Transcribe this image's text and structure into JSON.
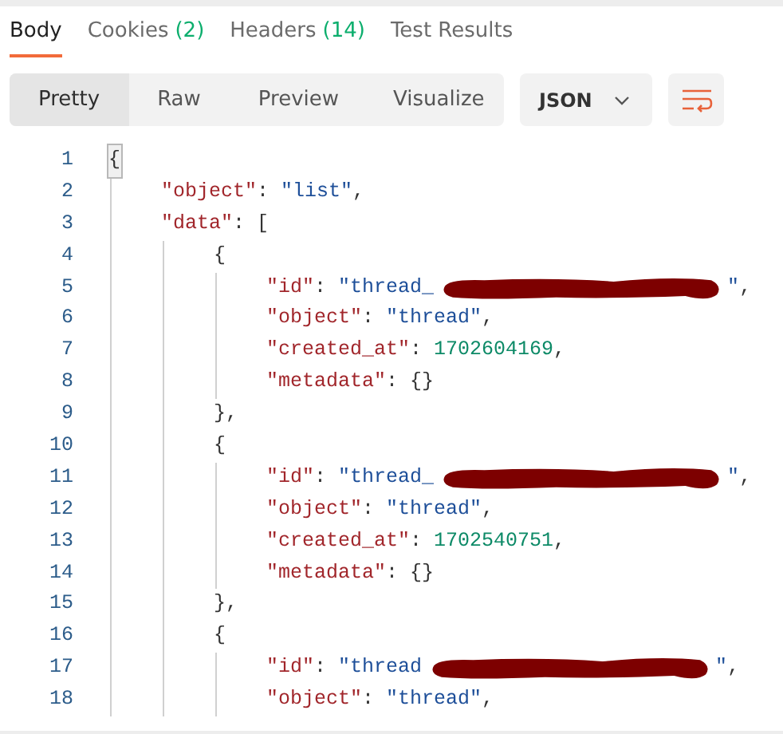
{
  "tabs": [
    {
      "label": "Body",
      "selected": true
    },
    {
      "label": "Cookies",
      "count": "(2)",
      "selected": false
    },
    {
      "label": "Headers",
      "count": "(14)",
      "selected": false
    },
    {
      "label": "Test Results",
      "selected": false
    }
  ],
  "view_modes": [
    {
      "label": "Pretty",
      "selected": true
    },
    {
      "label": "Raw",
      "selected": false
    },
    {
      "label": "Preview",
      "selected": false
    },
    {
      "label": "Visualize",
      "selected": false
    }
  ],
  "format_dropdown": {
    "value": "JSON"
  },
  "code": [
    {
      "number": "1",
      "tokens": [
        {
          "kind": "match",
          "text": "{"
        }
      ],
      "children": [
        {
          "number": "2",
          "tokens": [
            {
              "kind": "key",
              "text": "\"object\""
            },
            {
              "kind": "punct",
              "text": ": "
            },
            {
              "kind": "string",
              "text": "\"list\""
            },
            {
              "kind": "punct",
              "text": ","
            }
          ]
        },
        {
          "number": "3",
          "tokens": [
            {
              "kind": "key",
              "text": "\"data\""
            },
            {
              "kind": "punct",
              "text": ": ["
            }
          ],
          "children": [
            {
              "number": "4",
              "tokens": [
                {
                  "kind": "punct",
                  "text": "{"
                }
              ],
              "children": [
                {
                  "number": "5",
                  "tokens": [
                    {
                      "kind": "key",
                      "text": "\"id\""
                    },
                    {
                      "kind": "punct",
                      "text": ": "
                    },
                    {
                      "kind": "string",
                      "text": "\"thread_"
                    },
                    {
                      "kind": "redacted"
                    },
                    {
                      "kind": "string",
                      "text": "\""
                    },
                    {
                      "kind": "punct",
                      "text": ","
                    }
                  ]
                },
                {
                  "number": "6",
                  "tokens": [
                    {
                      "kind": "key",
                      "text": "\"object\""
                    },
                    {
                      "kind": "punct",
                      "text": ": "
                    },
                    {
                      "kind": "string",
                      "text": "\"thread\""
                    },
                    {
                      "kind": "punct",
                      "text": ","
                    }
                  ]
                },
                {
                  "number": "7",
                  "tokens": [
                    {
                      "kind": "key",
                      "text": "\"created_at\""
                    },
                    {
                      "kind": "punct",
                      "text": ": "
                    },
                    {
                      "kind": "number",
                      "text": "1702604169"
                    },
                    {
                      "kind": "punct",
                      "text": ","
                    }
                  ]
                },
                {
                  "number": "8",
                  "tokens": [
                    {
                      "kind": "key",
                      "text": "\"metadata\""
                    },
                    {
                      "kind": "punct",
                      "text": ": {}"
                    }
                  ]
                }
              ]
            },
            {
              "number": "9",
              "tokens": [
                {
                  "kind": "punct",
                  "text": "},"
                }
              ]
            },
            {
              "number": "10",
              "tokens": [
                {
                  "kind": "punct",
                  "text": "{"
                }
              ],
              "children": [
                {
                  "number": "11",
                  "tokens": [
                    {
                      "kind": "key",
                      "text": "\"id\""
                    },
                    {
                      "kind": "punct",
                      "text": ": "
                    },
                    {
                      "kind": "string",
                      "text": "\"thread_"
                    },
                    {
                      "kind": "redacted"
                    },
                    {
                      "kind": "string",
                      "text": "\""
                    },
                    {
                      "kind": "punct",
                      "text": ","
                    }
                  ]
                },
                {
                  "number": "12",
                  "tokens": [
                    {
                      "kind": "key",
                      "text": "\"object\""
                    },
                    {
                      "kind": "punct",
                      "text": ": "
                    },
                    {
                      "kind": "string",
                      "text": "\"thread\""
                    },
                    {
                      "kind": "punct",
                      "text": ","
                    }
                  ]
                },
                {
                  "number": "13",
                  "tokens": [
                    {
                      "kind": "key",
                      "text": "\"created_at\""
                    },
                    {
                      "kind": "punct",
                      "text": ": "
                    },
                    {
                      "kind": "number",
                      "text": "1702540751"
                    },
                    {
                      "kind": "punct",
                      "text": ","
                    }
                  ]
                },
                {
                  "number": "14",
                  "tokens": [
                    {
                      "kind": "key",
                      "text": "\"metadata\""
                    },
                    {
                      "kind": "punct",
                      "text": ": {}"
                    }
                  ]
                }
              ]
            },
            {
              "number": "15",
              "tokens": [
                {
                  "kind": "punct",
                  "text": "},"
                }
              ]
            },
            {
              "number": "16",
              "tokens": [
                {
                  "kind": "punct",
                  "text": "{"
                }
              ],
              "children": [
                {
                  "number": "17",
                  "tokens": [
                    {
                      "kind": "key",
                      "text": "\"id\""
                    },
                    {
                      "kind": "punct",
                      "text": ": "
                    },
                    {
                      "kind": "string",
                      "text": "\"thread"
                    },
                    {
                      "kind": "redacted"
                    },
                    {
                      "kind": "string",
                      "text": "\""
                    },
                    {
                      "kind": "punct",
                      "text": ","
                    }
                  ]
                },
                {
                  "number": "18",
                  "tokens": [
                    {
                      "kind": "key",
                      "text": "\"object\""
                    },
                    {
                      "kind": "punct",
                      "text": ": "
                    },
                    {
                      "kind": "string",
                      "text": "\"thread\""
                    },
                    {
                      "kind": "punct",
                      "text": ","
                    }
                  ]
                }
              ]
            }
          ]
        }
      ]
    }
  ]
}
